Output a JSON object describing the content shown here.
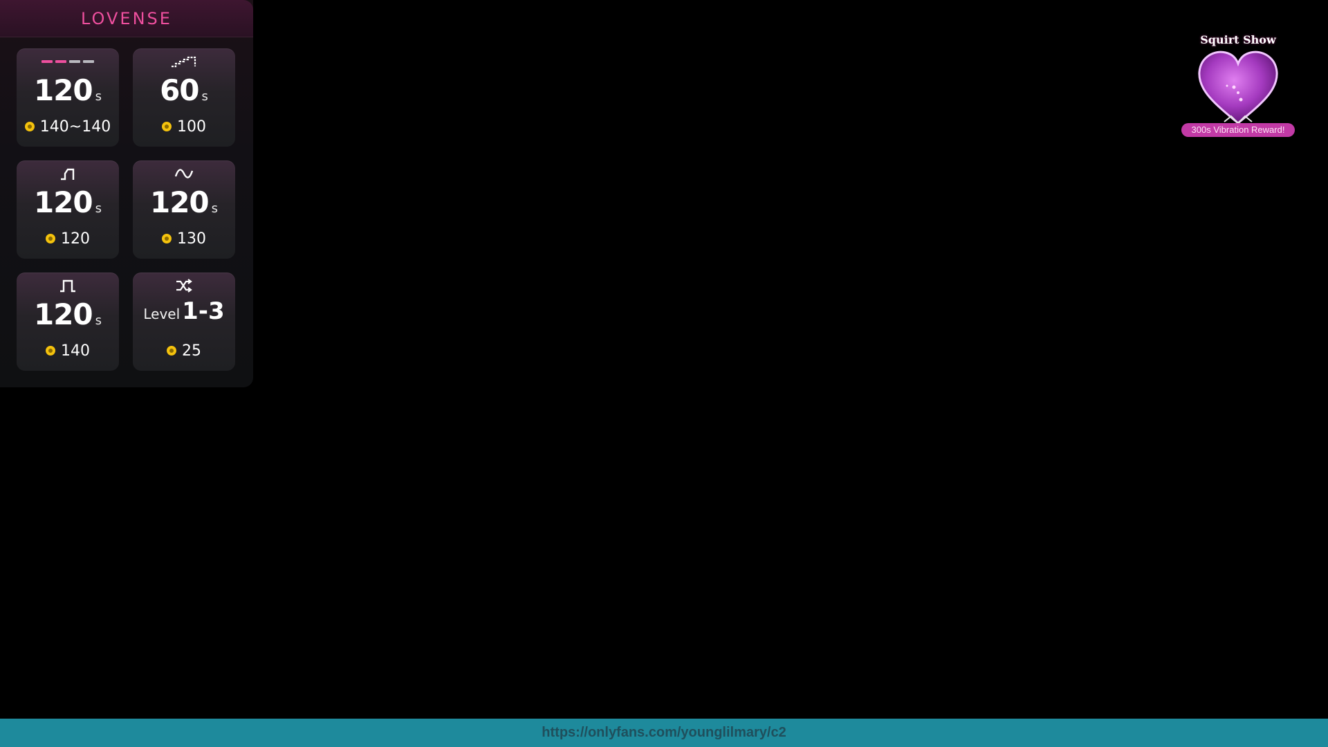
{
  "panel": {
    "brand": "LOVENSE",
    "cards": [
      {
        "icon": "pulse-pattern-icon",
        "value": "120",
        "unit": "s",
        "price": "140~140"
      },
      {
        "icon": "staircase-icon",
        "value": "60",
        "unit": "s",
        "price": "100"
      },
      {
        "icon": "step-up-icon",
        "value": "120",
        "unit": "s",
        "price": "120"
      },
      {
        "icon": "wave-icon",
        "value": "120",
        "unit": "s",
        "price": "130"
      },
      {
        "icon": "square-pulse-icon",
        "value": "120",
        "unit": "s",
        "price": "140"
      },
      {
        "icon": "shuffle-icon",
        "level_word": "Level",
        "level_value": "1-3",
        "price": "25"
      }
    ]
  },
  "reward": {
    "title": "Squirt Show",
    "label": "300s Vibration Reward!",
    "icon": "heart-icon"
  },
  "footer": {
    "url": "https://onlyfans.com/younglilmary/c2"
  },
  "colors": {
    "brand": "#ee4f9e",
    "coin": "#f4c20d",
    "footer_bg": "#1e8a9c",
    "reward_label_bg": "#c23aa6"
  }
}
